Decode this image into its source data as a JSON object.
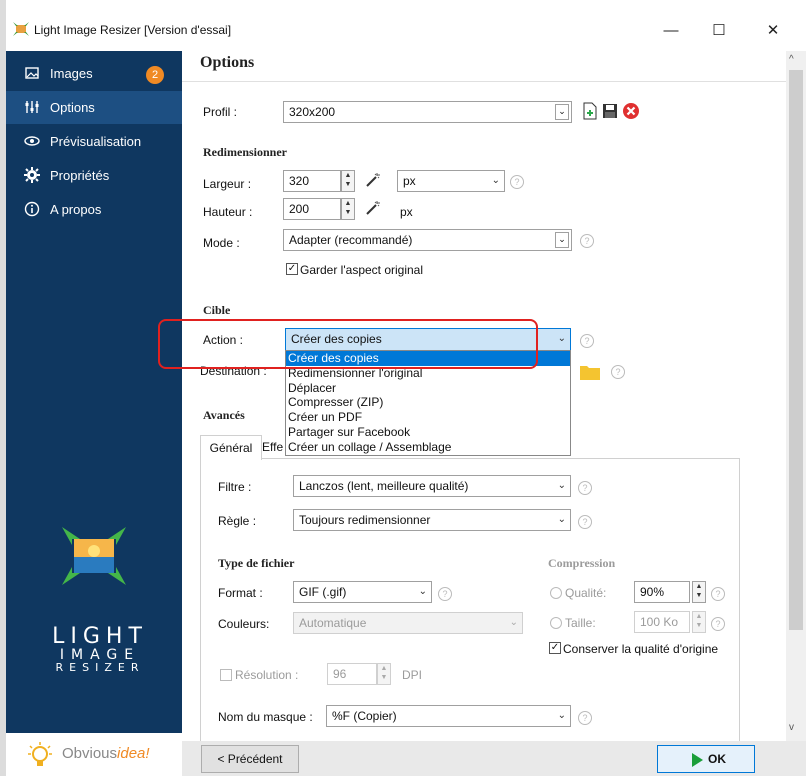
{
  "window": {
    "title": "Light Image Resizer  [Version d'essai]",
    "minimize": "—",
    "maximize": "☐",
    "close": "✕"
  },
  "sidebar": {
    "items": [
      {
        "label": "Images",
        "badge": "2",
        "icon": "images-icon"
      },
      {
        "label": "Options",
        "icon": "options-icon"
      },
      {
        "label": "Prévisualisation",
        "icon": "eye-icon"
      },
      {
        "label": "Propriétés",
        "icon": "gear-icon"
      },
      {
        "label": "A propos",
        "icon": "info-icon"
      }
    ],
    "logo_line1": "LIGHT",
    "logo_line2": "IMAGE",
    "logo_line3": "RESIZER",
    "brand_obvious": "Obvious",
    "brand_idea": "idea!"
  },
  "main": {
    "title": "Options",
    "profile_label": "Profil :",
    "profile_value": "320x200",
    "resize_heading": "Redimensionner",
    "width_label": "Largeur :",
    "width_value": "320",
    "unit_value": "px",
    "height_label": "Hauteur :",
    "height_value": "200",
    "height_unit": "px",
    "mode_label": "Mode :",
    "mode_value": "Adapter (recommandé)",
    "keep_aspect_label": "Garder l'aspect original",
    "target_heading": "Cible",
    "action_label": "Action :",
    "action_value": "Créer des copies",
    "action_options": [
      "Créer des copies",
      "Redimensionner l'original",
      "Déplacer",
      "Compresser (ZIP)",
      "Créer un PDF",
      "Partager sur Facebook",
      "Créer un collage / Assemblage"
    ],
    "destination_label": "Destination :",
    "advanced_heading": "Avancés",
    "tab_general": "Général",
    "tab_effects": "Effe",
    "filter_label": "Filtre :",
    "filter_value": "Lanczos  (lent, meilleure qualité)",
    "rule_label": "Règle :",
    "rule_value": "Toujours redimensionner",
    "filetype_heading": "Type de fichier",
    "format_label": "Format :",
    "format_value": "GIF (.gif)",
    "colors_label": "Couleurs:",
    "colors_value": "Automatique",
    "compression_heading": "Compression",
    "quality_label": "Qualité:",
    "quality_value": "90%",
    "size_label": "Taille:",
    "size_value": "100 Ko",
    "keep_quality_label": "Conserver la qualité d'origine",
    "resolution_label": "Résolution :",
    "resolution_value": "96",
    "resolution_unit": "DPI",
    "mask_label": "Nom du masque :",
    "mask_value": "%F (Copier)"
  },
  "footer": {
    "prev_button": "< Précédent",
    "ok_button": "OK"
  },
  "colors": {
    "sidebar_bg": "#0f3760",
    "sidebar_selected": "#1d4f82",
    "badge": "#f08a24",
    "selection_blue": "#0078d7",
    "annotation_red": "#e0211f",
    "ok_green": "#1a9e3a"
  }
}
